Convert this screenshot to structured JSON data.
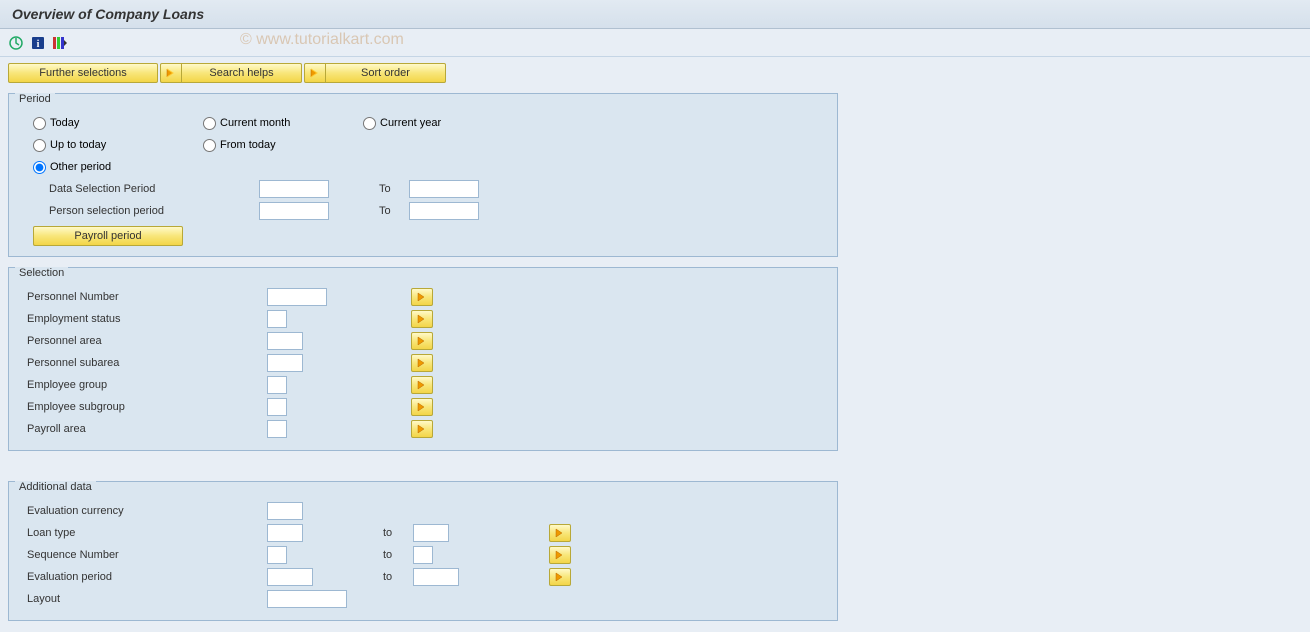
{
  "title": "Overview of Company Loans",
  "watermark": "© www.tutorialkart.com",
  "buttons": {
    "further_selections": "Further selections",
    "search_helps": "Search helps",
    "sort_order": "Sort order",
    "payroll_period": "Payroll period"
  },
  "groups": {
    "period": {
      "legend": "Period",
      "radios": {
        "today": "Today",
        "current_month": "Current month",
        "current_year": "Current year",
        "up_to_today": "Up to today",
        "from_today": "From today",
        "other_period": "Other period"
      },
      "fields": {
        "data_selection_period": "Data Selection Period",
        "person_selection_period": "Person selection period",
        "to": "To"
      }
    },
    "selection": {
      "legend": "Selection",
      "fields": {
        "personnel_number": "Personnel Number",
        "employment_status": "Employment status",
        "personnel_area": "Personnel area",
        "personnel_subarea": "Personnel subarea",
        "employee_group": "Employee group",
        "employee_subgroup": "Employee subgroup",
        "payroll_area": "Payroll area"
      }
    },
    "additional": {
      "legend": "Additional data",
      "fields": {
        "evaluation_currency": "Evaluation currency",
        "loan_type": "Loan type",
        "sequence_number": "Sequence Number",
        "evaluation_period": "Evaluation period",
        "layout": "Layout",
        "to": "to"
      }
    }
  }
}
